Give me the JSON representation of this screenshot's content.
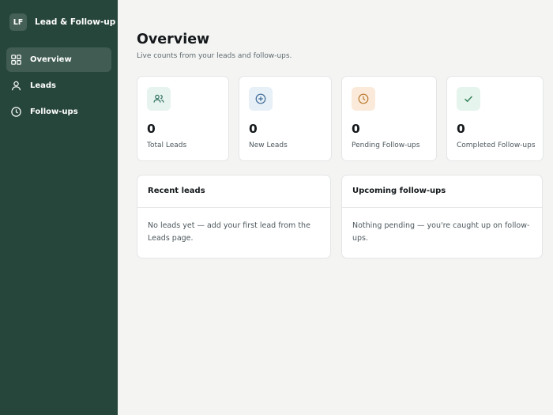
{
  "brand": {
    "logo": "LF",
    "name": "Lead & Follow-up"
  },
  "nav": [
    {
      "label": "Overview",
      "icon": "grid-icon",
      "active": true
    },
    {
      "label": "Leads",
      "icon": "user-icon",
      "active": false
    },
    {
      "label": "Follow-ups",
      "icon": "clock-icon",
      "active": false
    }
  ],
  "header": {
    "title": "Overview",
    "subtitle": "Live counts from your leads and follow-ups."
  },
  "stats": [
    {
      "value": "0",
      "label": "Total Leads",
      "icon": "users-icon",
      "color": "#e6f3ef"
    },
    {
      "value": "0",
      "label": "New Leads",
      "icon": "plus-circle-icon",
      "color": "#e7eff7"
    },
    {
      "value": "0",
      "label": "Pending Follow-ups",
      "icon": "clock-icon",
      "color": "#fbeada"
    },
    {
      "value": "0",
      "label": "Completed Follow-ups",
      "icon": "check-icon",
      "color": "#e5f4ec"
    }
  ],
  "panels": {
    "recent_leads": {
      "title": "Recent leads",
      "empty": "No leads yet — add your first lead from the Leads page."
    },
    "upcoming_followups": {
      "title": "Upcoming follow-ups",
      "empty": "Nothing pending — you're caught up on follow-ups."
    }
  },
  "colors": {
    "sidebar": "#27463b",
    "accent_users": "#2f6f5e",
    "accent_new": "#3e6b95",
    "accent_pending": "#b9772a",
    "accent_completed": "#2f7d56"
  }
}
